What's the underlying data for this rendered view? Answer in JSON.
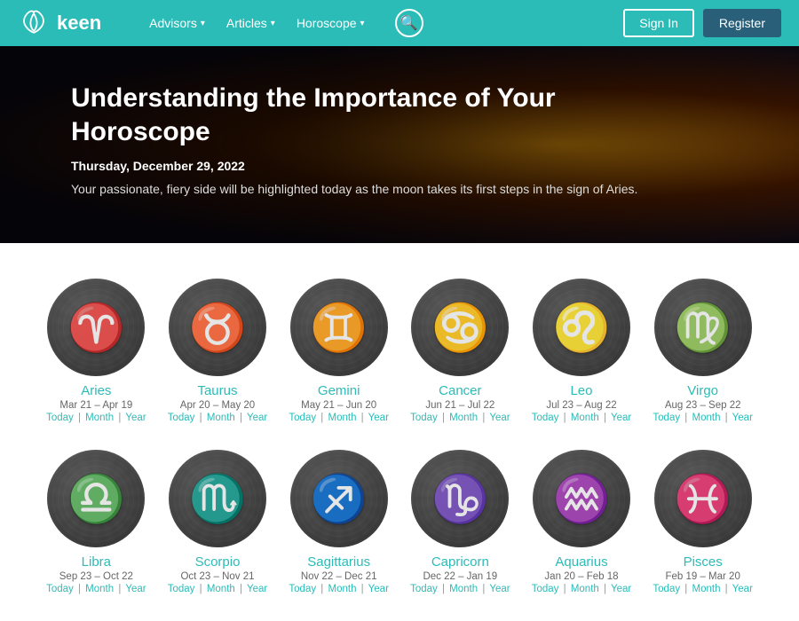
{
  "header": {
    "logo_text": "keen",
    "nav_items": [
      {
        "label": "Advisors",
        "has_dropdown": true
      },
      {
        "label": "Articles",
        "has_dropdown": true
      },
      {
        "label": "Horoscope",
        "has_dropdown": true
      }
    ],
    "signin_label": "Sign In",
    "register_label": "Register"
  },
  "hero": {
    "title": "Understanding the Importance of Your Horoscope",
    "date": "Thursday, December 29, 2022",
    "description": "Your passionate, fiery side will be highlighted today as the moon takes its first steps in the sign of Aries."
  },
  "zodiac": {
    "signs_row1": [
      {
        "name": "Aries",
        "symbol": "♈",
        "dates": "Mar 21 – Apr 19"
      },
      {
        "name": "Taurus",
        "symbol": "♉",
        "dates": "Apr 20 – May 20"
      },
      {
        "name": "Gemini",
        "symbol": "♊",
        "dates": "May 21 – Jun 20"
      },
      {
        "name": "Cancer",
        "symbol": "♋",
        "dates": "Jun 21 – Jul 22"
      },
      {
        "name": "Leo",
        "symbol": "♌",
        "dates": "Jul 23 – Aug 22"
      },
      {
        "name": "Virgo",
        "symbol": "♍",
        "dates": "Aug 23 – Sep 22"
      }
    ],
    "signs_row2": [
      {
        "name": "Libra",
        "symbol": "♎",
        "dates": "Sep 23 – Oct 22"
      },
      {
        "name": "Scorpio",
        "symbol": "♏",
        "dates": "Oct 23 – Nov 21"
      },
      {
        "name": "Sagittarius",
        "symbol": "♐",
        "dates": "Nov 22 – Dec 21"
      },
      {
        "name": "Capricorn",
        "symbol": "♑",
        "dates": "Dec 22 – Jan 19"
      },
      {
        "name": "Aquarius",
        "symbol": "♒",
        "dates": "Jan 20 – Feb 18"
      },
      {
        "name": "Pisces",
        "symbol": "♓",
        "dates": "Feb 19 – Mar 20"
      }
    ],
    "link_today": "Today",
    "link_month": "Month",
    "link_year": "Year"
  }
}
